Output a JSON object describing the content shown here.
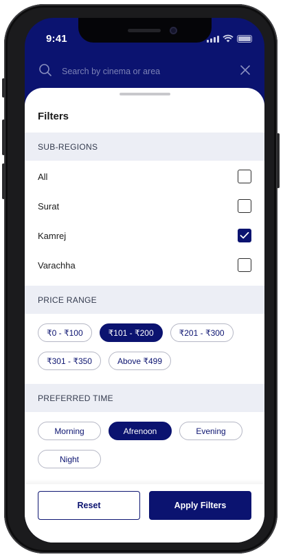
{
  "colors": {
    "primary": "#0b1370",
    "section_bg": "#eceef5",
    "chip_border": "#b4b6c4"
  },
  "status_bar": {
    "time": "9:41"
  },
  "search": {
    "placeholder": "Search by cinema or area",
    "value": "",
    "icon": "search-icon",
    "close_icon": "close-icon"
  },
  "sheet": {
    "title": "Filters"
  },
  "sub_regions": {
    "header": "SUB-REGIONS",
    "items": [
      {
        "label": "All",
        "checked": false
      },
      {
        "label": "Surat",
        "checked": false
      },
      {
        "label": "Kamrej",
        "checked": true
      },
      {
        "label": "Varachha",
        "checked": false
      }
    ]
  },
  "price_range": {
    "header": "PRICE RANGE",
    "options": [
      {
        "label": "₹0 - ₹100",
        "selected": false
      },
      {
        "label": "₹101 - ₹200",
        "selected": true
      },
      {
        "label": "₹201 - ₹300",
        "selected": false
      },
      {
        "label": "₹301 - ₹350",
        "selected": false
      },
      {
        "label": "Above ₹499",
        "selected": false
      }
    ]
  },
  "preferred_time": {
    "header": "PREFERRED TIME",
    "options": [
      {
        "label": "Morning",
        "selected": false
      },
      {
        "label": "Afrenoon",
        "selected": true
      },
      {
        "label": "Evening",
        "selected": false
      },
      {
        "label": "Night",
        "selected": false
      }
    ]
  },
  "footer": {
    "reset_label": "Reset",
    "apply_label": "Apply Filters"
  }
}
